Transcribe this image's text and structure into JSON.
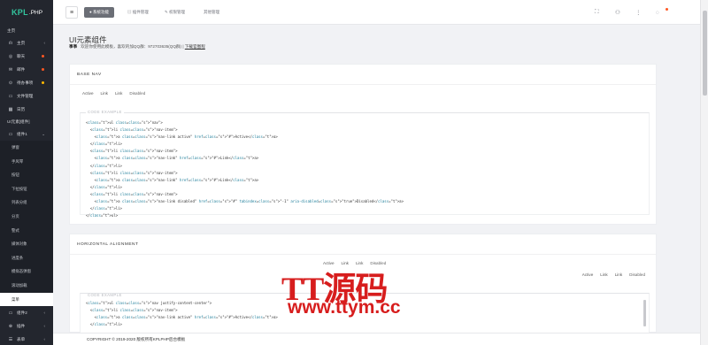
{
  "brand": {
    "kpl": "KPL",
    "php": ".PHP"
  },
  "sidebar": {
    "section_main": "主页",
    "items": [
      {
        "label": "主页",
        "icon": "bar-chart-icon",
        "glyph": "ılı",
        "chevron": "‹"
      },
      {
        "label": "聊天",
        "icon": "chat-icon",
        "glyph": "◎",
        "dot": "#ff5722"
      },
      {
        "label": "邮件",
        "icon": "mail-icon",
        "glyph": "✉",
        "dot": "#ff5722"
      },
      {
        "label": "待办事项",
        "icon": "todo-icon",
        "glyph": "⊙",
        "dot": "#ffb800"
      },
      {
        "label": "文件管理",
        "icon": "file-icon",
        "glyph": "▭"
      },
      {
        "label": "日历",
        "icon": "calendar-icon",
        "glyph": "▦"
      }
    ],
    "section_ui": "UI元素[组件]",
    "group1": {
      "label": "组件1",
      "glyph": "▭",
      "chevron": "⌄"
    },
    "subitems": [
      "弹窗",
      "手风琴",
      "按钮",
      "下拉按钮",
      "列表分组",
      "分页",
      "警式",
      "媒体对象",
      "进度条",
      "模拟态弹窗",
      "滚动加载",
      "菜单"
    ],
    "active_subitem": 11,
    "group2": {
      "label": "组件2",
      "glyph": "▭",
      "chevron": "‹"
    },
    "item_plugin": {
      "label": "插件",
      "glyph": "⊕",
      "chevron": "‹"
    },
    "item_form": {
      "label": "表单",
      "glyph": "☰",
      "chevron": "‹"
    }
  },
  "topbar": {
    "menu_glyph": "≡",
    "home_label": "● 系统功能",
    "tabs": [
      {
        "label": "▤ 插件管理",
        "name": "tab-plugin-manage"
      },
      {
        "label": "✎ 权限管理",
        "name": "tab-permission-manage"
      },
      {
        "label": "其他管理",
        "name": "tab-other-manage"
      }
    ],
    "icons": [
      {
        "name": "fullscreen-icon",
        "glyph": "⛶"
      },
      {
        "name": "user-icon",
        "glyph": "⚇"
      },
      {
        "name": "settings-icon",
        "glyph": "⋮"
      },
      {
        "name": "notification-icon",
        "glyph": "◌"
      }
    ],
    "notify_color": "#ff5722"
  },
  "page": {
    "title": "UI元素组件",
    "notice_lead": "事事",
    "notice_text": "欢迎你使用此模板，喜欢的加QQ群：972703635(QQ群)",
    "notice_link": "下载官图程"
  },
  "cards": [
    {
      "heading": "BASE NAV",
      "nav": [
        "Active",
        "Link",
        "Link",
        "Disabled"
      ],
      "code_label": "CODE EXAMPLE",
      "code": [
        "<ul class=\"nav\">",
        "  <li class=\"nav-item\">",
        "    <a class=\"nav-link active\" href=\"#\">Active</a>",
        "  </li>",
        "  <li class=\"nav-item\">",
        "    <a class=\"nav-link\" href=\"#\">Link</a>",
        "  </li>",
        "  <li class=\"nav-item\">",
        "    <a class=\"nav-link\" href=\"#\">Link</a>",
        "  </li>",
        "  <li class=\"nav-item\">",
        "    <a class=\"nav-link disabled\" href=\"#\" tabindex=\"-1\" aria-disabled=\"true\">Disabled</a>",
        "  </li>",
        "</ul>"
      ]
    },
    {
      "heading": "HORIZONTAL ALIGNMENT",
      "nav_center": [
        "Active",
        "Link",
        "Link",
        "Disabled"
      ],
      "nav_right": [
        "Active",
        "Link",
        "Link",
        "Disabled"
      ],
      "code_label": "CODE EXAMPLE",
      "code": [
        "<ul class=\"nav justify-content-center\">",
        "  <li class=\"nav-item\">",
        "    <a class=\"nav-link active\" href=\"#\">Active</a>",
        "  </li>"
      ]
    }
  ],
  "footer": {
    "text": "COPYRIGHT © 2019-2020 版权所有KPLPHP后台模板"
  },
  "watermark": {
    "cn": "TT源码",
    "url": "www.ttym.cc",
    "color": "#d71d1d"
  }
}
